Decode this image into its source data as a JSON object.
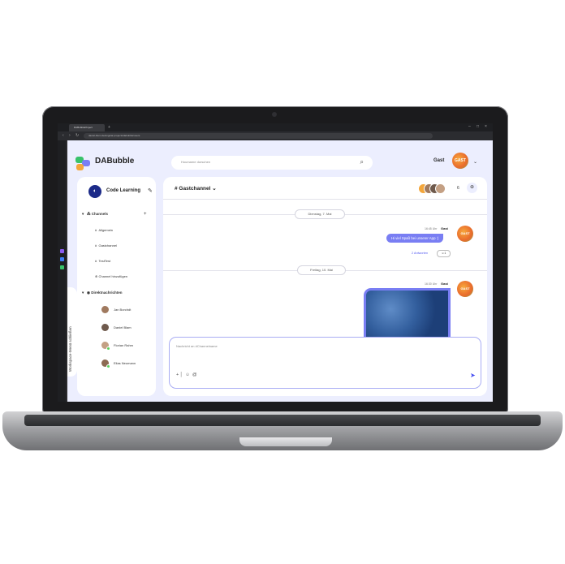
{
  "browser": {
    "tab_title": "DABubbleProject",
    "url": "daniel-blem.de/angular-projects/dabubble/users"
  },
  "header": {
    "logo_text": "DABubble",
    "search_placeholder": "Houmame durschen",
    "user_name": "Gast",
    "user_avatar_text": "GAST"
  },
  "sidebar": {
    "workspace_title": "Code Learning",
    "channels_heading": "Channels",
    "channels": [
      "Allgemein",
      "Gastchannel",
      "TestTest"
    ],
    "add_channel_label": "Channel hinzufügen",
    "dm_heading": "Direktnachrichten",
    "direct_messages": [
      "Jan Borchdt",
      "Daniel Blam",
      "Florian Rahm",
      "Elias Neumann"
    ],
    "menu_toggle_label": "Workspace-Menü schließen"
  },
  "main": {
    "channel_title": "# Gastchannel",
    "member_count": "6",
    "date_1": "Dienstag, 7. Mai",
    "date_2": "Freitag, 10. Mai",
    "msg1": {
      "time": "16:45 Uhr",
      "author": "Gast",
      "text": "Hi viel Spaß bei unserer App :)",
      "answers": "2 Antworten",
      "reaction": "1"
    },
    "msg2": {
      "time": "16:30 Uhr",
      "author": "Gast"
    },
    "input_placeholder": "Nachricht an #Channelname"
  }
}
